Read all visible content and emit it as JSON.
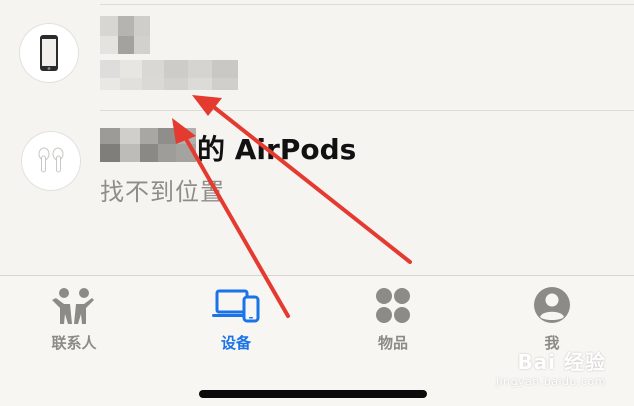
{
  "devices": [
    {
      "icon": "iphone-icon",
      "name": "",
      "status": ""
    },
    {
      "icon": "airpods-icon",
      "name": "的 AirPods",
      "status": "找不到位置"
    }
  ],
  "tabbar": {
    "tabs": [
      {
        "label": "联系人",
        "icon": "people-icon",
        "active": false
      },
      {
        "label": "设备",
        "icon": "devices-icon",
        "active": true
      },
      {
        "label": "物品",
        "icon": "items-icon",
        "active": false
      },
      {
        "label": "我",
        "icon": "me-icon",
        "active": false
      }
    ]
  },
  "watermark": {
    "main": "Bai 经验",
    "sub": "jingyan.baidu.com"
  },
  "colors": {
    "accent": "#1a73e8",
    "inactive": "#8c8b88",
    "annotation": "#e53a2f",
    "background": "#f5f4f1"
  }
}
